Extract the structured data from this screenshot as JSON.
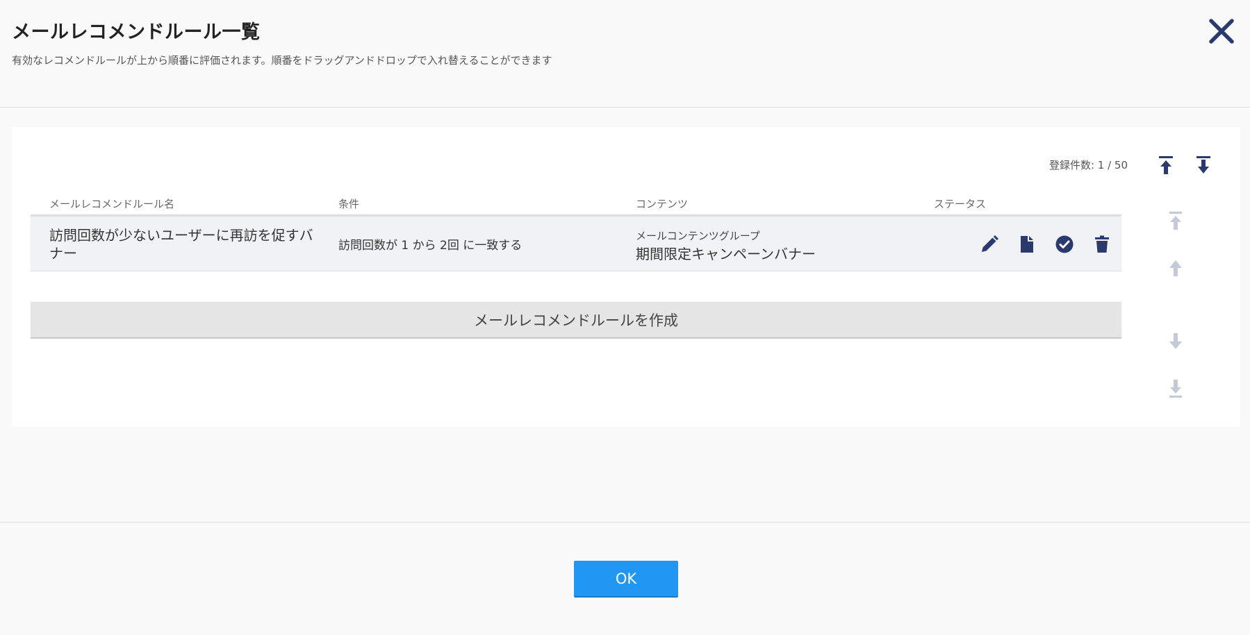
{
  "header": {
    "title": "メールレコメンドルール一覧",
    "subtitle": "有効なレコメンドルールが上から順番に評価されます。順番をドラッグアンドドロップで入れ替えることができます"
  },
  "toolbar": {
    "count": "登録件数: 1 / 50"
  },
  "table": {
    "columns": [
      "メールレコメンドルール名",
      "条件",
      "コンテンツ",
      "ステータス"
    ],
    "rows": [
      {
        "name": "訪問回数が少ないユーザーに再訪を促すバナー",
        "condition": "訪問回数が 1 から 2回 に一致する",
        "content_label": "メールコンテンツグループ",
        "content_value": "期間限定キャンペーンバナー"
      }
    ]
  },
  "create_button": "メールレコメンドルールを作成",
  "ok_button": "OK",
  "icons": {
    "close": "close-icon",
    "move_to_top": "move-to-top-icon",
    "move_to_bottom": "move-to-bottom-icon",
    "edit": "pencil-icon",
    "copy": "document-copy-icon",
    "status": "check-circle-icon",
    "delete": "trash-icon",
    "side": [
      "move-to-top-icon",
      "arrow-up-icon",
      "arrow-down-icon",
      "move-to-bottom-icon"
    ]
  },
  "colors": {
    "accent": "#2a3a6c",
    "primary_button": "#2196f3",
    "disabled_icon": "#c4cad8"
  }
}
